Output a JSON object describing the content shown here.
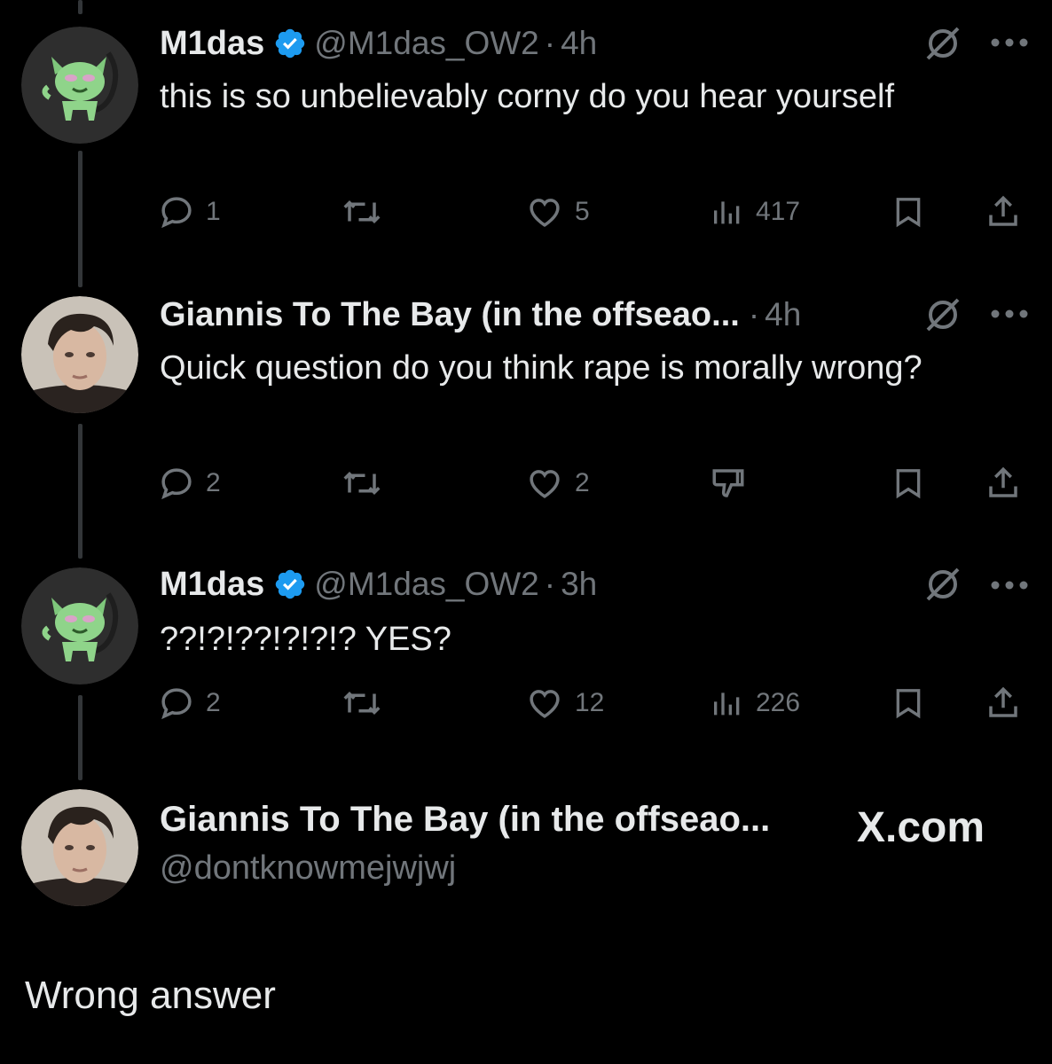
{
  "tweets": [
    {
      "name": "M1das",
      "handle": "@M1das_OW2",
      "time": "4h",
      "verified": true,
      "text": "this is so unbelievably corny do you hear yourself",
      "replies": "1",
      "likes": "5",
      "views": "417"
    },
    {
      "name": "Giannis To The Bay (in the offseao...",
      "time": "4h",
      "text": "Quick question do you think rape is morally wrong?",
      "replies": "2",
      "likes": "2"
    },
    {
      "name": "M1das",
      "handle": "@M1das_OW2",
      "time": "3h",
      "verified": true,
      "text": "??!?!??!?!?!? YES?",
      "replies": "2",
      "likes": "12",
      "views": "226"
    }
  ],
  "quoted": {
    "name": "Giannis To The Bay (in the offseao...",
    "handle": "@dontknowmejwjwj",
    "site": "X.com"
  },
  "caption": "Wrong answer",
  "colors": {
    "background": "#000000",
    "text": "#e7e9ea",
    "muted": "#71767b",
    "verified": "#1d9bf0"
  }
}
